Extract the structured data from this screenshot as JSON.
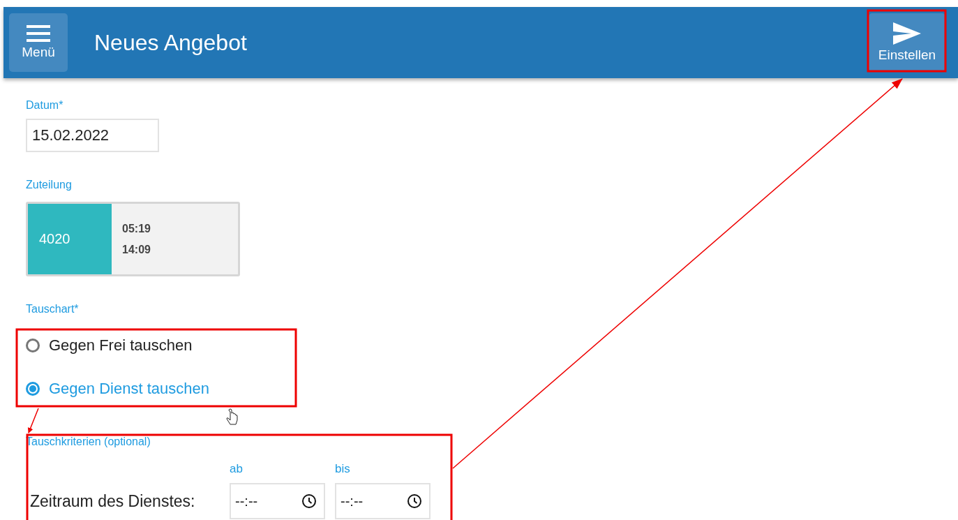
{
  "header": {
    "menu_button": "Menü",
    "title": "Neues Angebot",
    "submit_button": "Einstellen"
  },
  "form": {
    "date": {
      "label": "Datum*",
      "value": "15.02.2022"
    },
    "assignment": {
      "label": "Zuteilung",
      "code": "4020",
      "start": "05:19",
      "end": "14:09"
    },
    "swap_type": {
      "label": "Tauschart*",
      "options": [
        {
          "label": "Gegen Frei tauschen",
          "selected": false
        },
        {
          "label": "Gegen Dienst tauschen",
          "selected": true
        }
      ]
    },
    "criteria": {
      "label": "Tauschkriterien (optional)",
      "period_label": "Zeitraum des Dienstes:",
      "fields": [
        {
          "label": "ab",
          "placeholder": "--:--"
        },
        {
          "label": "bis",
          "placeholder": "--:--"
        }
      ]
    }
  }
}
